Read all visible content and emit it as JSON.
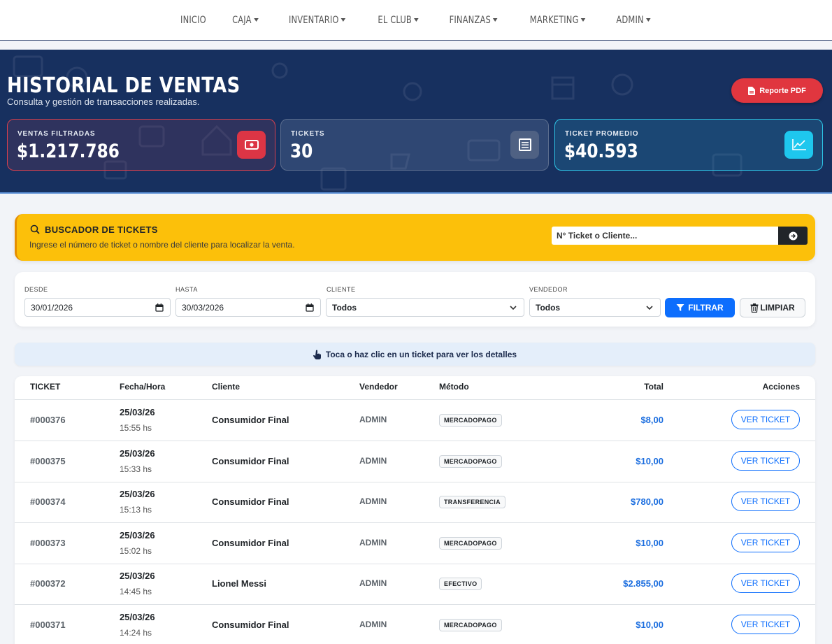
{
  "nav": {
    "items": [
      {
        "label": "INICIO",
        "caret": false
      },
      {
        "label": "CAJA",
        "caret": true
      },
      {
        "label": "INVENTARIO",
        "caret": true
      },
      {
        "label": "EL CLUB",
        "caret": true
      },
      {
        "label": "FINANZAS",
        "caret": true
      },
      {
        "label": "MARKETING",
        "caret": true
      },
      {
        "label": "ADMIN",
        "caret": true
      }
    ]
  },
  "header": {
    "title": "HISTORIAL DE VENTAS",
    "subtitle": "Consulta y gestión de transacciones realizadas.",
    "pdf_button": "Reporte PDF"
  },
  "stats": [
    {
      "label": "VENTAS FILTRADAS",
      "value": "$1.217.786",
      "icon": "cash-icon",
      "color": "#dc3545"
    },
    {
      "label": "TICKETS",
      "value": "30",
      "icon": "receipt-icon",
      "color": "#4f6183"
    },
    {
      "label": "TICKET PROMEDIO",
      "value": "$40.593",
      "icon": "chart-line-icon",
      "color": "#1ec7ee"
    }
  ],
  "search": {
    "title": "BUSCADOR DE TICKETS",
    "description": "Ingrese el número de ticket o nombre del cliente para localizar la venta.",
    "placeholder": "N° Ticket o Cliente..."
  },
  "filters": {
    "desde_label": "DESDE",
    "desde_value": "30/01/2026",
    "hasta_label": "HASTA",
    "hasta_value": "30/03/2026",
    "cliente_label": "CLIENTE",
    "cliente_value": "Todos",
    "vendedor_label": "VENDEDOR",
    "vendedor_value": "Todos",
    "filter_button": "FILTRAR",
    "clear_button": "LIMPIAR"
  },
  "hint": "Toca o haz clic en un ticket para ver los detalles",
  "table": {
    "headers": {
      "ticket": "TICKET",
      "fecha": "Fecha/Hora",
      "cliente": "Cliente",
      "vendedor": "Vendedor",
      "metodo": "Método",
      "total": "Total",
      "acciones": "Acciones"
    },
    "rows": [
      {
        "ticket": "#000376",
        "date": "25/03/26",
        "time": "15:55 hs",
        "client": "Consumidor Final",
        "seller": "ADMIN",
        "method": "MERCADOPAGO",
        "total": "$8,00",
        "action": "VER TICKET"
      },
      {
        "ticket": "#000375",
        "date": "25/03/26",
        "time": "15:33 hs",
        "client": "Consumidor Final",
        "seller": "ADMIN",
        "method": "MERCADOPAGO",
        "total": "$10,00",
        "action": "VER TICKET"
      },
      {
        "ticket": "#000374",
        "date": "25/03/26",
        "time": "15:13 hs",
        "client": "Consumidor Final",
        "seller": "ADMIN",
        "method": "TRANSFERENCIA",
        "total": "$780,00",
        "action": "VER TICKET"
      },
      {
        "ticket": "#000373",
        "date": "25/03/26",
        "time": "15:02 hs",
        "client": "Consumidor Final",
        "seller": "ADMIN",
        "method": "MERCADOPAGO",
        "total": "$10,00",
        "action": "VER TICKET"
      },
      {
        "ticket": "#000372",
        "date": "25/03/26",
        "time": "14:45 hs",
        "client": "Lionel Messi",
        "seller": "ADMIN",
        "method": "EFECTIVO",
        "total": "$2.855,00",
        "action": "VER TICKET"
      },
      {
        "ticket": "#000371",
        "date": "25/03/26",
        "time": "14:24 hs",
        "client": "Consumidor Final",
        "seller": "ADMIN",
        "method": "MERCADOPAGO",
        "total": "$10,00",
        "action": "VER TICKET"
      }
    ]
  }
}
